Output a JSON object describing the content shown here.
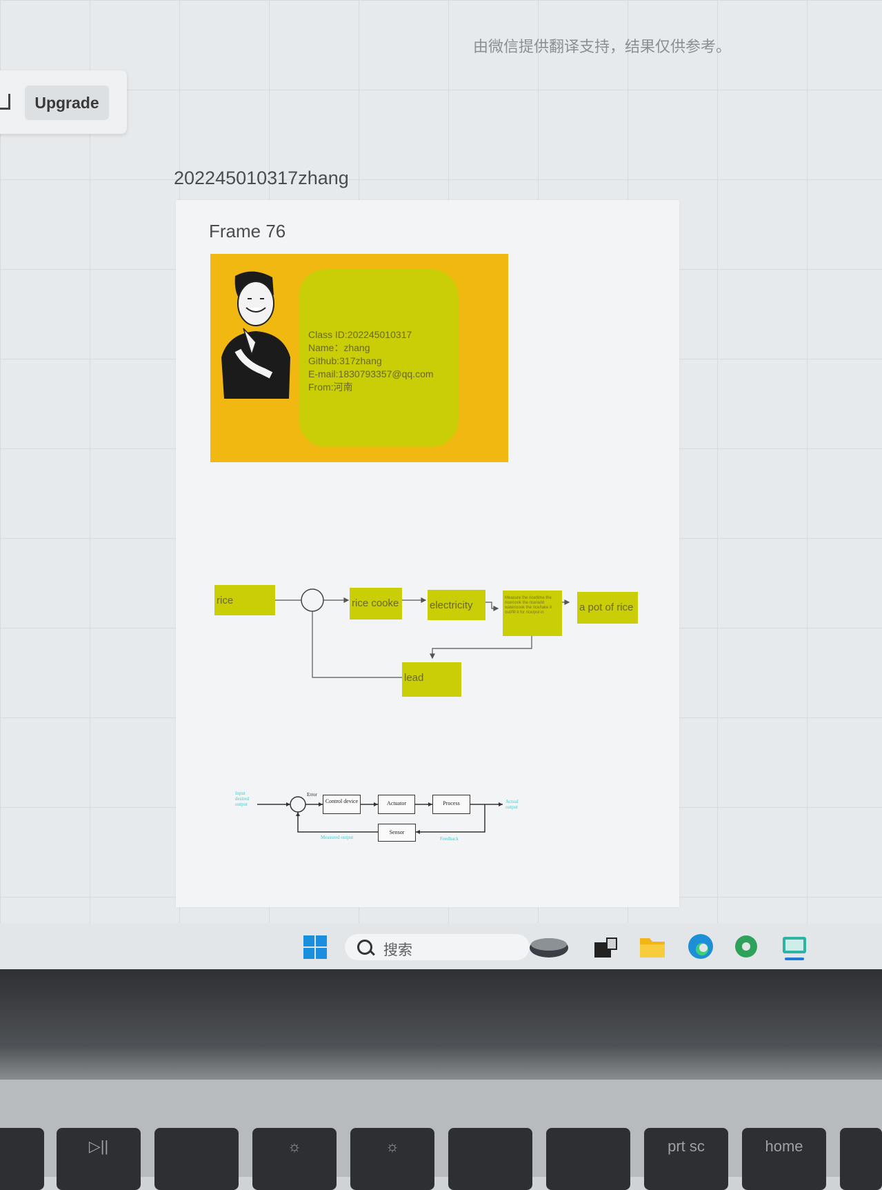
{
  "banner": {
    "text": "由微信提供翻译支持，结果仅供参考。"
  },
  "toolbar": {
    "upgrade_label": "Upgrade"
  },
  "board": {
    "title": "202245010317zhang"
  },
  "frame": {
    "label": "Frame 76",
    "card": {
      "lines": [
        "Class  ID:202245010317",
        "Name：zhang",
        "Github:317zhang",
        "E-mail:1830793357@qq.com",
        "From:河南"
      ],
      "colors": {
        "card": "#f2b812",
        "box": "#c9ce07"
      }
    },
    "diagram": {
      "rice": "rice",
      "rice_cooker": "rice cooke",
      "electricity": "electricity",
      "measure": "Measure the rice/time the rice/cook the rice/add water/cook the rice/take it out/fill it for rice/put in",
      "output": "a pot of rice",
      "lead": "lead"
    },
    "control_diagram": {
      "input_label": "Input desired output",
      "error": "Error",
      "controller": "Control device",
      "actuator": "Actuator",
      "process": "Process",
      "sensor": "Sensor",
      "actual_output": "Actual output",
      "measured_output": "Measured output",
      "feedback": "Feedback"
    }
  },
  "taskbar": {
    "search_placeholder": "搜索",
    "icons": [
      "windows-start-icon",
      "search-icon",
      "widget-icon",
      "task-view-icon",
      "file-explorer-icon",
      "edge-icon",
      "chrome-icon",
      "remote-desktop-icon"
    ]
  },
  "keyboard": {
    "keys": [
      "",
      "▷||",
      "",
      "☼",
      "☼",
      "",
      "",
      "prt sc",
      "home",
      ""
    ]
  }
}
